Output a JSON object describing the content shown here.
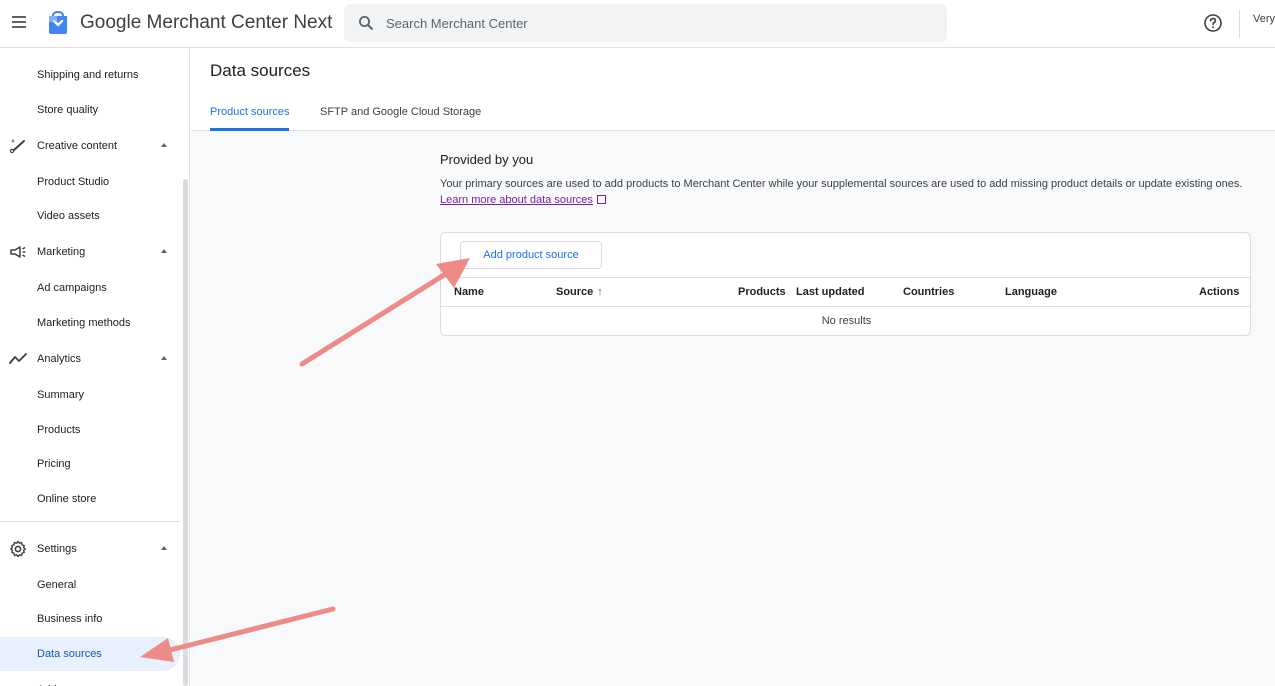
{
  "header": {
    "app_title": "Google Merchant Center Next",
    "search_placeholder": "Search Merchant Center",
    "account_text": "Very"
  },
  "sidebar": {
    "items": [
      {
        "label": "Shipping and returns"
      },
      {
        "label": "Store quality"
      },
      {
        "label": "Creative content",
        "icon": "creative-content-icon",
        "expanded": true
      },
      {
        "label": "Product Studio"
      },
      {
        "label": "Video assets"
      },
      {
        "label": "Marketing",
        "icon": "megaphone-icon",
        "expanded": true
      },
      {
        "label": "Ad campaigns"
      },
      {
        "label": "Marketing methods"
      },
      {
        "label": "Analytics",
        "icon": "trending-icon",
        "expanded": true
      },
      {
        "label": "Summary"
      },
      {
        "label": "Products"
      },
      {
        "label": "Pricing"
      },
      {
        "label": "Online store"
      },
      {
        "label": "Settings",
        "icon": "gear-icon",
        "expanded": true
      },
      {
        "label": "General"
      },
      {
        "label": "Business info"
      },
      {
        "label": "Data sources",
        "active": true
      },
      {
        "label": "Add..."
      }
    ]
  },
  "main": {
    "page_title": "Data sources",
    "tabs": [
      {
        "label": "Product sources",
        "active": true
      },
      {
        "label": "SFTP and Google Cloud Storage",
        "active": false
      }
    ],
    "section": {
      "title": "Provided by you",
      "description": "Your primary sources are used to add products to Merchant Center while your supplemental sources are used to add missing product details or update existing ones.",
      "learn_more_link": "Learn more about data sources"
    },
    "add_button_label": "Add product source",
    "table": {
      "columns": [
        "Name",
        "Source",
        "Products",
        "Last updated",
        "Countries",
        "Language",
        "Actions"
      ],
      "sort_indicator": "↑",
      "empty_text": "No results"
    }
  },
  "colors": {
    "accent": "#1a73e8",
    "active_nav_bg": "#e8f0fe",
    "link_visited": "#7b1fa2",
    "annotation_arrow": "#ee8a87"
  }
}
